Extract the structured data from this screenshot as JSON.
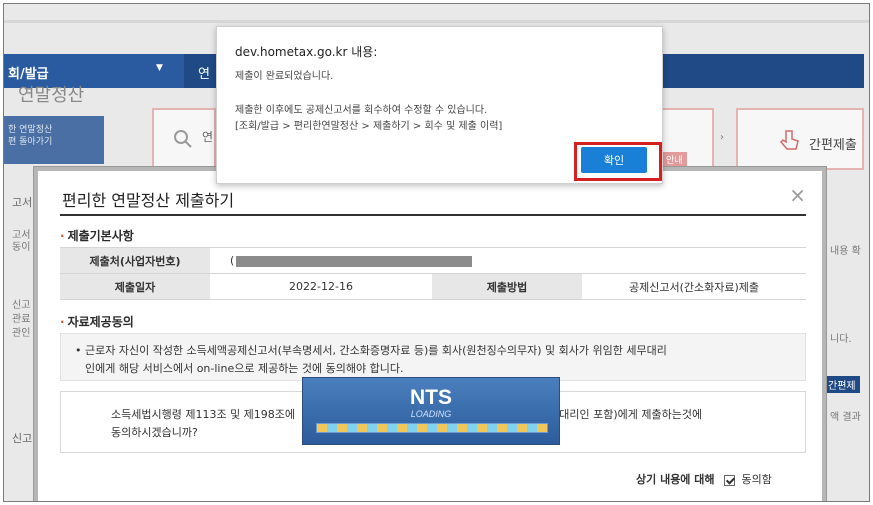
{
  "background": {
    "nav_left_label": "회/발급",
    "nav_second_label": "연",
    "page_heading": "연말정산",
    "side_panel_line1": "한 연말정산",
    "side_panel_line2": "편 돌아가기",
    "step_fragment": "연",
    "step_badge": "안내",
    "simple_submit_label": "간편제출",
    "left_fragments": [
      "고서",
      "고서",
      "동이",
      "신고",
      "관료",
      "관인",
      "신고"
    ],
    "right_fragments": [
      "내용 확",
      "니다.",
      "간편제",
      "액 결과"
    ]
  },
  "modal": {
    "title": "편리한 연말정산 제출하기",
    "close_symbol": "×",
    "basic_section_title": "제출기본사항",
    "submitter_label": "제출처(사업자번호)",
    "submitter_value_prefix": "(",
    "submit_date_label": "제출일자",
    "submit_date_value": "2022-12-16",
    "submit_method_label": "제출방법",
    "submit_method_value": "공제신고서(간소화자료)제출",
    "consent_section_title": "자료제공동의",
    "consent_line1": "• 근로자 자신이 작성한 소득세액공제신고서(부속명세서, 간소화증명자료 등)를 회사(원천징수의무자) 및 회사가 위임한 세무대리",
    "consent_line2": "인에게 해당 서비스에서 on-line으로 제공하는 것에 동의해야 합니다.",
    "agree_line1_left": "소득세법시행령 제113조 및 제198조에",
    "agree_line1_right": "세무대리인 포함)에게 제출하는것에",
    "agree_line2": "동의하시겠습니까?",
    "agree_question": "상기 내용에 대해",
    "agree_label": "동의함"
  },
  "loading": {
    "title": "NTS",
    "subtitle": "LOADING",
    "progress": 1.0
  },
  "alert": {
    "origin": "dev.hometax.go.kr 내용:",
    "line1": "제출이 완료되었습니다.",
    "line2": "제출한 이후에도 공제신고서를 회수하여 수정할 수 있습니다.",
    "line3": "[조회/발급 > 편리한연말정산 > 제출하기 > 회수 및 제출 이력]",
    "ok_label": "확인"
  },
  "colors": {
    "nav_blue": "#1f4a86",
    "ok_blue": "#1a7fd6",
    "highlight_red": "#d42020"
  }
}
